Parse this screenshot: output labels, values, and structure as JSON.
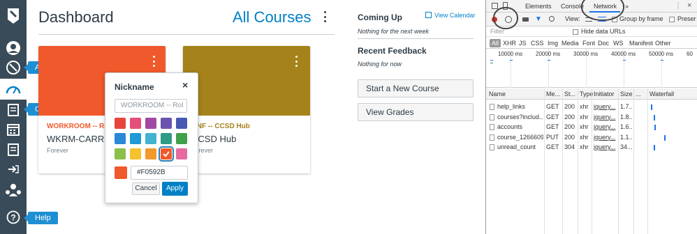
{
  "nav": {
    "tooltips": {
      "admin": "Admin",
      "courses": "Courses",
      "help": "Help"
    }
  },
  "header": {
    "title": "Dashboard",
    "all_courses": "All Courses"
  },
  "cards": [
    {
      "color": "#F0592B",
      "code": "WORKROOM -- Ro",
      "name": "WKRM-CARROL",
      "term": "Forever",
      "code_color": "#F0592B"
    },
    {
      "color": "#A5821A",
      "code": "ONF -- CCSD Hub",
      "name": "CCSD Hub",
      "term": "Forever",
      "code_color": "#A5821A"
    }
  ],
  "popover": {
    "title": "Nickname",
    "close": "×",
    "nickname_placeholder": "WORKROOM -- Rol",
    "swatch_colors": [
      "#E8453C",
      "#E4507A",
      "#A04AA4",
      "#6B54B0",
      "#4758B2",
      "#2B88D8",
      "#1E9AD6",
      "#43B3D0",
      "#2D9B85",
      "#41A04A",
      "#8CC04B",
      "#F6C12E",
      "#F39A2B",
      "#F0592B",
      "#E66AA0"
    ],
    "selected_index": 13,
    "hex_value": "#F0592B",
    "cancel_label": "Cancel",
    "apply_label": "Apply"
  },
  "sidebar": {
    "coming_up": "Coming Up",
    "view_calendar": "View Calendar",
    "coming_up_empty": "Nothing for the next week",
    "recent_feedback": "Recent Feedback",
    "recent_feedback_empty": "Nothing for now",
    "start_course_button": "Start a New Course",
    "view_grades_button": "View Grades"
  },
  "devtools": {
    "tabs": [
      "Elements",
      "Console",
      "Network",
      "»"
    ],
    "active_tab": "Network",
    "toolbar": {
      "view_label": "View:",
      "group_by_frame": "Group by frame",
      "preserve": "Preser"
    },
    "filter_placeholder": "Filter",
    "hide_data_urls": "Hide data URLs",
    "types": [
      "All",
      "XHR",
      "JS",
      "CSS",
      "Img",
      "Media",
      "Font",
      "Doc",
      "WS",
      "Manifest",
      "Other"
    ],
    "timeline_labels": [
      "10000 ms",
      "20000 ms",
      "30000 ms",
      "40000 ms",
      "50000 ms",
      "60"
    ],
    "columns": [
      "Name",
      "Me...",
      "St...",
      "Type",
      "Initiator",
      "Size",
      "...",
      "Waterfall"
    ],
    "rows": [
      {
        "name": "help_links",
        "method": "GET",
        "status": "200",
        "type": "xhr",
        "initiator": "jquery...",
        "size": "1.7..."
      },
      {
        "name": "courses?includ...",
        "method": "GET",
        "status": "200",
        "type": "xhr",
        "initiator": "jquery...",
        "size": "1.8..."
      },
      {
        "name": "accounts",
        "method": "GET",
        "status": "200",
        "type": "xhr",
        "initiator": "jquery...",
        "size": "1.6..."
      },
      {
        "name": "course_1266609",
        "method": "PUT",
        "status": "200",
        "type": "xhr",
        "initiator": "jquery...",
        "size": "1.1..."
      },
      {
        "name": "unread_count",
        "method": "GET",
        "status": "304",
        "type": "xhr",
        "initiator": "jquery...",
        "size": "34..."
      }
    ]
  }
}
